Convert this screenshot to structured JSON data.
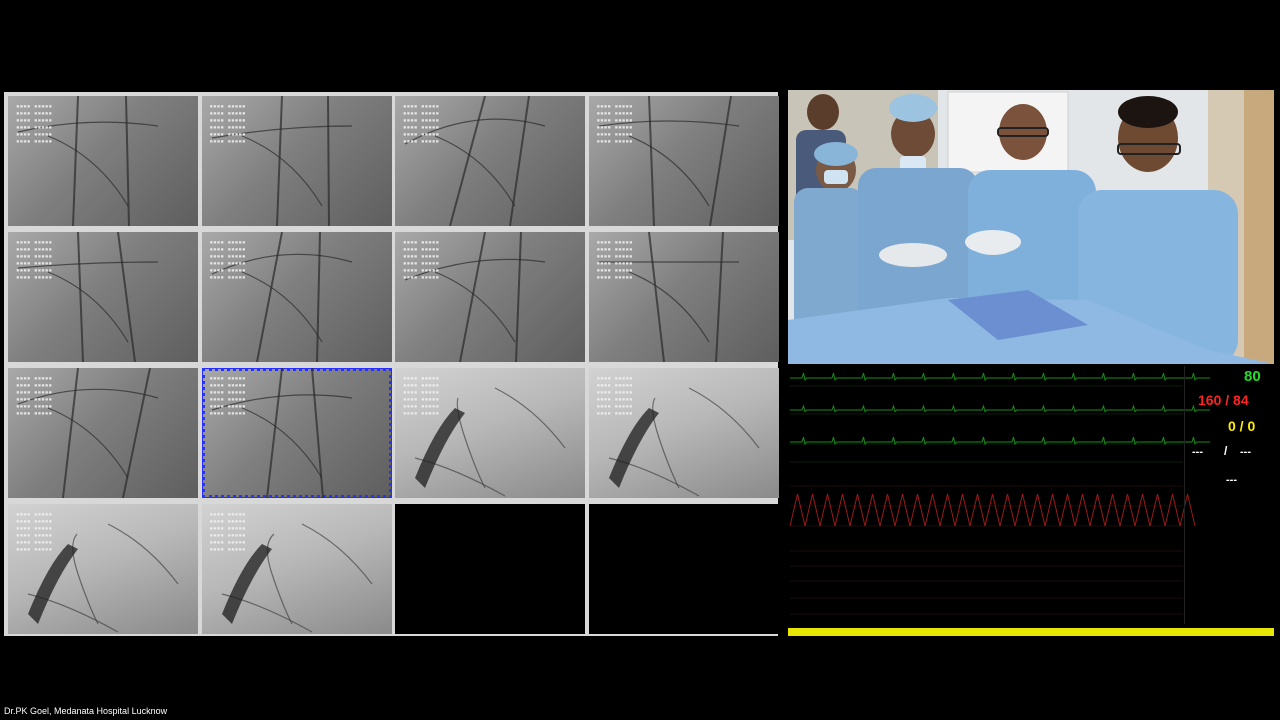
{
  "footer": {
    "caption": "Dr.PK Goel, Medanata Hospital Lucknow"
  },
  "angiography": {
    "thumbnails": [
      {
        "row": 1,
        "col": 1,
        "state": "filled",
        "tone": "mid"
      },
      {
        "row": 1,
        "col": 2,
        "state": "filled",
        "tone": "mid"
      },
      {
        "row": 1,
        "col": 3,
        "state": "filled",
        "tone": "mid"
      },
      {
        "row": 1,
        "col": 4,
        "state": "filled",
        "tone": "mid"
      },
      {
        "row": 2,
        "col": 1,
        "state": "filled",
        "tone": "mid"
      },
      {
        "row": 2,
        "col": 2,
        "state": "filled",
        "tone": "mid"
      },
      {
        "row": 2,
        "col": 3,
        "state": "filled",
        "tone": "mid"
      },
      {
        "row": 2,
        "col": 4,
        "state": "filled",
        "tone": "mid"
      },
      {
        "row": 3,
        "col": 1,
        "state": "filled",
        "tone": "mid"
      },
      {
        "row": 3,
        "col": 2,
        "state": "selected",
        "tone": "mid"
      },
      {
        "row": 3,
        "col": 3,
        "state": "filled",
        "tone": "light"
      },
      {
        "row": 3,
        "col": 4,
        "state": "filled",
        "tone": "light"
      },
      {
        "row": 4,
        "col": 1,
        "state": "filled",
        "tone": "light"
      },
      {
        "row": 4,
        "col": 2,
        "state": "filled",
        "tone": "light"
      },
      {
        "row": 4,
        "col": 3,
        "state": "empty"
      },
      {
        "row": 4,
        "col": 4,
        "state": "empty"
      }
    ],
    "selected_border_color": "#2233ff"
  },
  "monitor": {
    "heart_rate": "80",
    "blood_pressure": "160 / 84",
    "secondary_pressure": "0 / 0",
    "dash_left": "---",
    "dash_slash": "/",
    "dash_right": "---",
    "dash_bottom": "---",
    "colors": {
      "hr": "#22dd22",
      "bp": "#ff2222",
      "pressure": "#ffee00",
      "ecg": "#1a8a1a",
      "status_bar": "#e6e600"
    }
  }
}
